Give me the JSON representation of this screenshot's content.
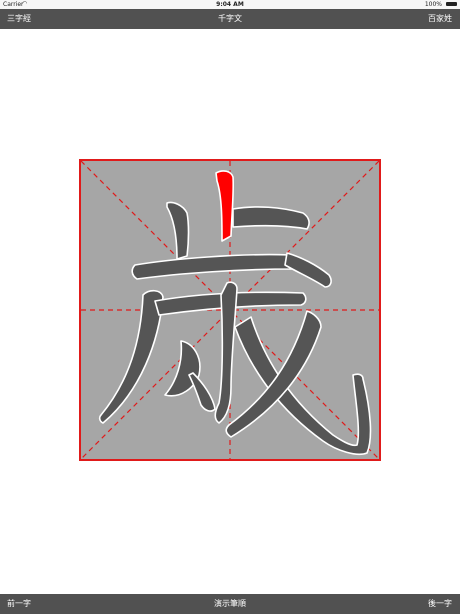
{
  "status_bar": {
    "carrier": "Carrier",
    "time": "9:04 AM",
    "battery": "100%"
  },
  "top_bar": {
    "left": "三字經",
    "center": "千字文",
    "right": "百家姓"
  },
  "bottom_bar": {
    "left": "前一字",
    "center": "演示筆順",
    "right": "後一字"
  },
  "canvas": {
    "background_color": "#a6a6a6",
    "border_color": "#e01a1a",
    "guide_color": "#e01a1a",
    "stroke_color": "#555555",
    "active_stroke_color": "#ff0000"
  }
}
